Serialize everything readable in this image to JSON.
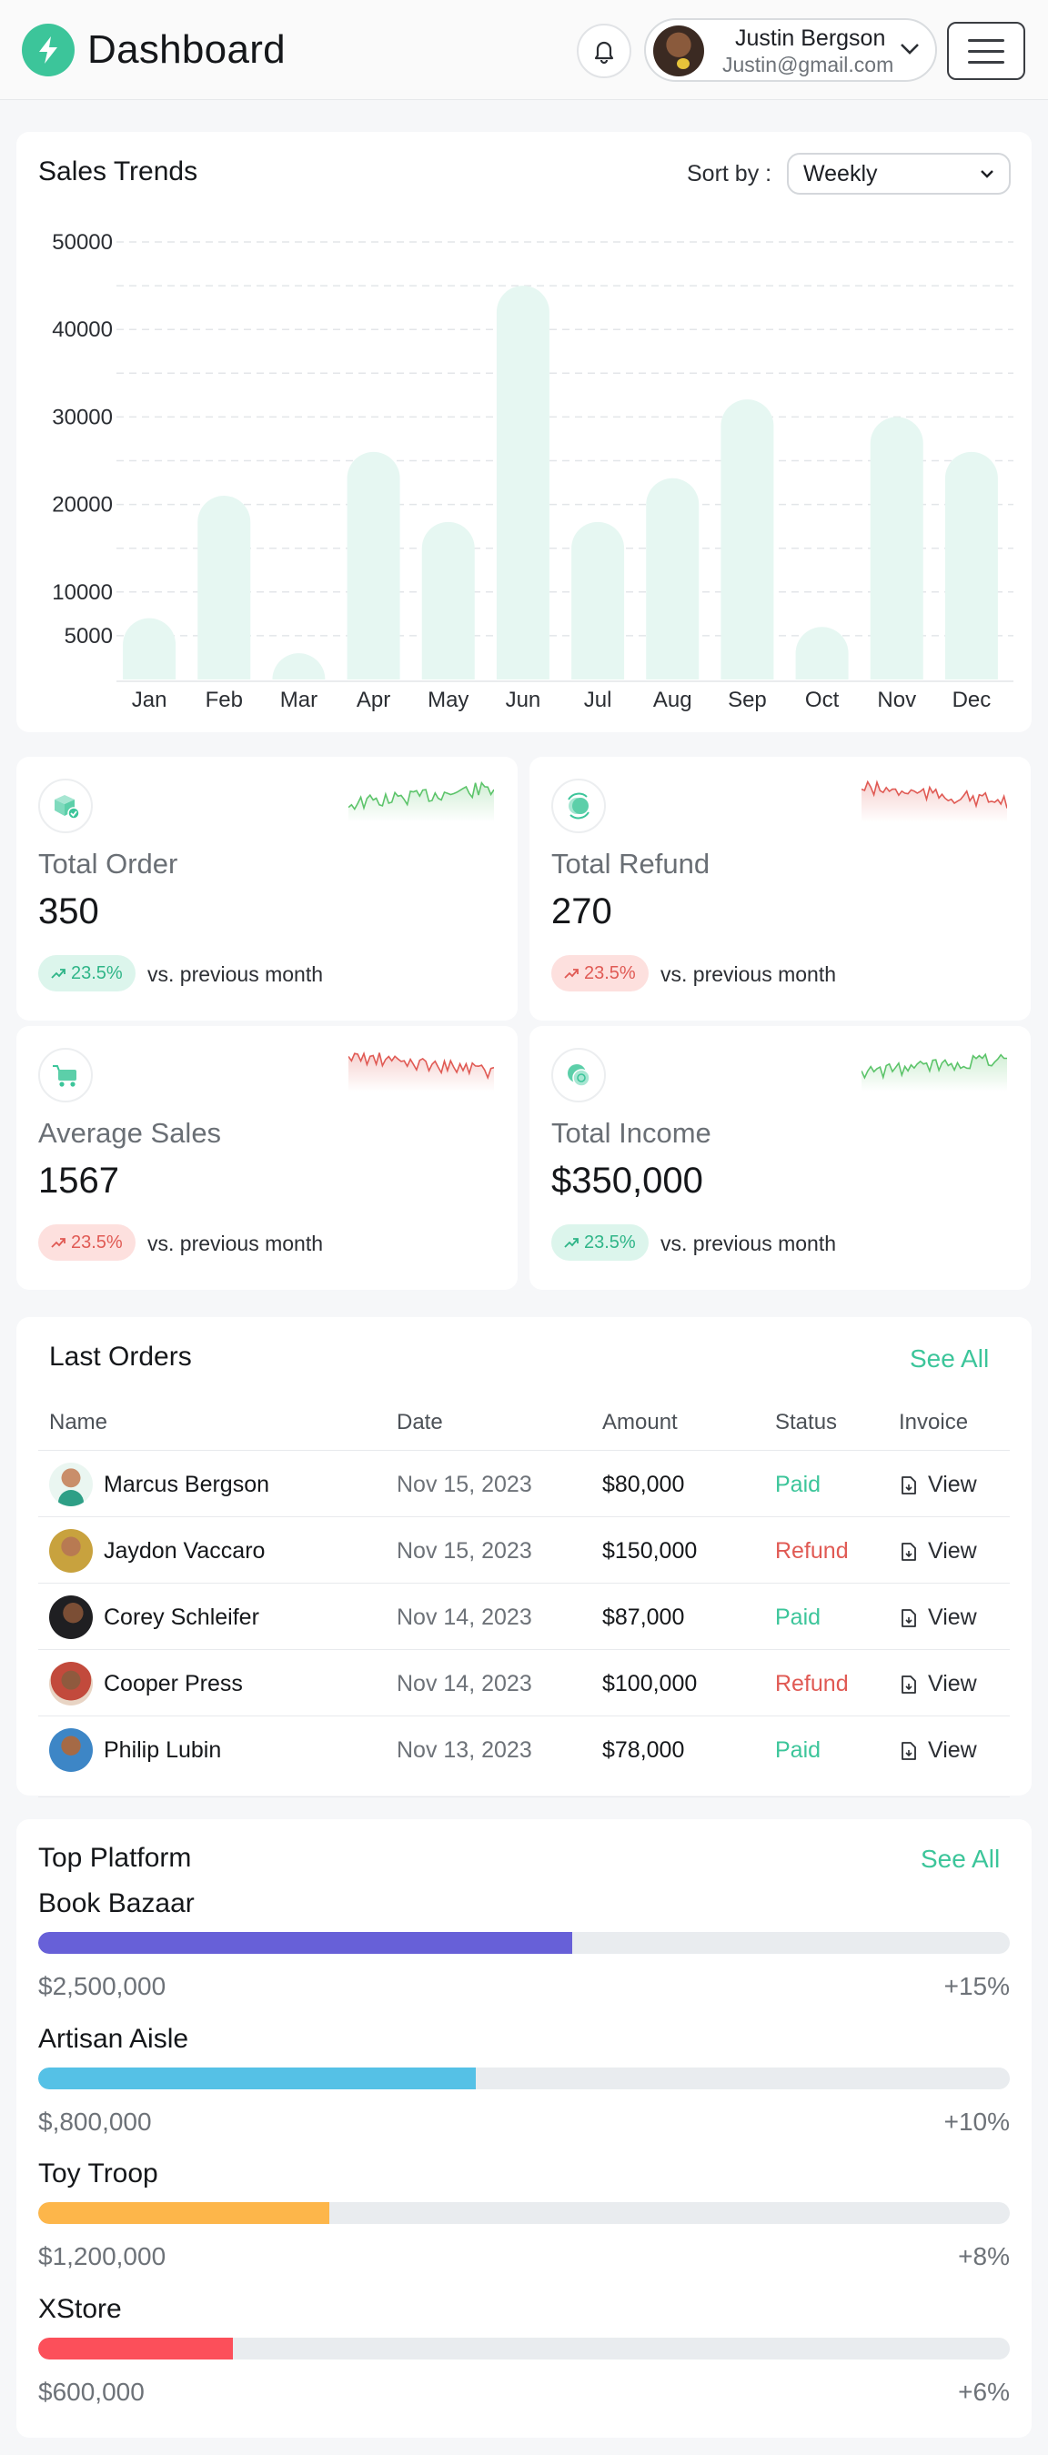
{
  "header": {
    "title": "Dashboard",
    "user": {
      "name": "Justin Bergson",
      "email": "Justin@gmail.com"
    }
  },
  "sales": {
    "title": "Sales Trends",
    "sort_label": "Sort by :",
    "sort_value": "Weekly"
  },
  "chart_data": {
    "type": "bar",
    "title": "Sales Trends",
    "categories": [
      "Jan",
      "Feb",
      "Mar",
      "Apr",
      "May",
      "Jun",
      "Jul",
      "Aug",
      "Sep",
      "Oct",
      "Nov",
      "Dec"
    ],
    "values": [
      7000,
      21000,
      3000,
      26000,
      18000,
      45000,
      18000,
      23000,
      32000,
      6000,
      30000,
      26000
    ],
    "ytick_labels": [
      "5000",
      "10000",
      "20000",
      "30000",
      "40000",
      "50000"
    ],
    "yticks": [
      5000,
      10000,
      20000,
      30000,
      40000,
      50000
    ],
    "ylim": [
      0,
      50000
    ],
    "grid": true,
    "color": "#e6f7f2"
  },
  "stats": [
    {
      "label": "Total Order",
      "value": "350",
      "change": "23.5%",
      "trend": "up",
      "compare": "vs. previous month",
      "icon": "box-icon",
      "spark_color": "#5cc46a"
    },
    {
      "label": "Total Refund",
      "value": "270",
      "change": "23.5%",
      "trend": "down",
      "compare": "vs. previous month",
      "icon": "refund-icon",
      "spark_color": "#e05a54"
    },
    {
      "label": "Average Sales",
      "value": "1567",
      "change": "23.5%",
      "trend": "down",
      "compare": "vs. previous month",
      "icon": "cart-icon",
      "spark_color": "#e05a54"
    },
    {
      "label": "Total Income",
      "value": "$350,000",
      "change": "23.5%",
      "trend": "up",
      "compare": "vs. previous month",
      "icon": "coins-icon",
      "spark_color": "#5cc46a"
    }
  ],
  "orders": {
    "title": "Last Orders",
    "see_all": "See All",
    "columns": [
      "Name",
      "Date",
      "Amount",
      "Status",
      "Invoice"
    ],
    "rows": [
      {
        "name": "Marcus Bergson",
        "date": "Nov 15, 2023",
        "amount": "$80,000",
        "status": "Paid",
        "invoice": "View"
      },
      {
        "name": "Jaydon Vaccaro",
        "date": "Nov 15, 2023",
        "amount": "$150,000",
        "status": "Refund",
        "invoice": "View"
      },
      {
        "name": "Corey Schleifer",
        "date": "Nov 14, 2023",
        "amount": "$87,000",
        "status": "Paid",
        "invoice": "View"
      },
      {
        "name": "Cooper Press",
        "date": "Nov 14, 2023",
        "amount": "$100,000",
        "status": "Refund",
        "invoice": "View"
      },
      {
        "name": "Philip Lubin",
        "date": "Nov 13, 2023",
        "amount": "$78,000",
        "status": "Paid",
        "invoice": "View"
      }
    ]
  },
  "platforms": {
    "title": "Top Platform",
    "see_all": "See All",
    "items": [
      {
        "name": "Book Bazaar",
        "amount": "$2,500,000",
        "change": "+15%",
        "progress": 0.55,
        "color": "#6760d8"
      },
      {
        "name": "Artisan Aisle",
        "amount": "$,800,000",
        "change": "+10%",
        "progress": 0.45,
        "color": "#55c1e6"
      },
      {
        "name": "Toy Troop",
        "amount": "$1,200,000",
        "change": "+8%",
        "progress": 0.3,
        "color": "#fdb64a"
      },
      {
        "name": "XStore",
        "amount": "$600,000",
        "change": "+6%",
        "progress": 0.2,
        "color": "#fc4f5a"
      }
    ]
  }
}
